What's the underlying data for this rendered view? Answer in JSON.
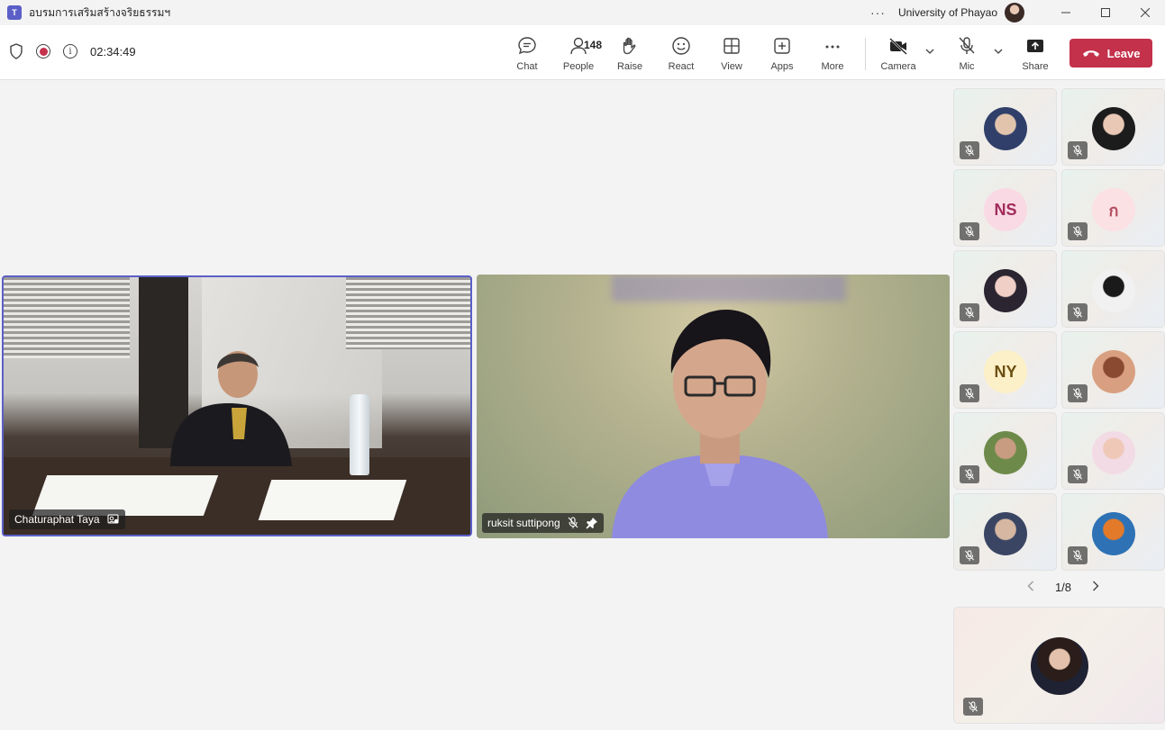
{
  "window": {
    "title": "อบรมการเสริมสร้างจริยธรรมฯ",
    "org": "University of Phayao",
    "more_dots": "···"
  },
  "toolbar": {
    "timer": "02:34:49",
    "people_count": "148",
    "buttons": {
      "chat": "Chat",
      "people": "People",
      "raise": "Raise",
      "react": "React",
      "view": "View",
      "apps": "Apps",
      "more": "More",
      "camera": "Camera",
      "mic": "Mic",
      "share": "Share"
    },
    "leave": "Leave"
  },
  "stage": {
    "tiles": [
      {
        "name": "Chaturaphat Taya",
        "muted": false,
        "pinned": false,
        "active_speaker": true
      },
      {
        "name": "ruksit suttipong",
        "muted": true,
        "pinned": true,
        "active_speaker": false
      }
    ]
  },
  "gallery": {
    "tiles": [
      {
        "initials": "",
        "type": "photo",
        "muted": true,
        "colors": [
          "#2f3f6a",
          "#e2c4ad"
        ]
      },
      {
        "initials": "",
        "type": "photo",
        "muted": true,
        "colors": [
          "#1c1c1c",
          "#e9c9b5"
        ]
      },
      {
        "initials": "NS",
        "type": "initials",
        "muted": true,
        "colors": [
          "#f9d9e3",
          "#a12a59"
        ]
      },
      {
        "initials": "ก",
        "type": "initials",
        "muted": true,
        "colors": [
          "#fbe0e4",
          "#b44b5e"
        ]
      },
      {
        "initials": "",
        "type": "photo",
        "muted": true,
        "colors": [
          "#2a2530",
          "#f0cfc6"
        ]
      },
      {
        "initials": "",
        "type": "photo",
        "muted": true,
        "colors": [
          "#f1f1f1",
          "#1a1a1a"
        ]
      },
      {
        "initials": "NY",
        "type": "initials",
        "muted": true,
        "colors": [
          "#fcf0c8",
          "#6b4e10"
        ]
      },
      {
        "initials": "",
        "type": "photo",
        "muted": true,
        "colors": [
          "#d8a080",
          "#8a4a32"
        ]
      },
      {
        "initials": "",
        "type": "photo",
        "muted": true,
        "colors": [
          "#6e8a4a",
          "#c79c80"
        ]
      },
      {
        "initials": "",
        "type": "photo",
        "muted": true,
        "colors": [
          "#f2dbe5",
          "#efc8b8"
        ]
      },
      {
        "initials": "",
        "type": "photo",
        "muted": true,
        "colors": [
          "#3a4563",
          "#d6b7a2"
        ]
      },
      {
        "initials": "",
        "type": "photo",
        "muted": true,
        "colors": [
          "#2e72b5",
          "#e27a2a"
        ]
      }
    ],
    "pager": "1/8"
  },
  "self_view": {
    "muted": true
  },
  "colors": {
    "accent": "#5b5fc7",
    "leave": "#c4314b",
    "record": "#c4314b"
  }
}
